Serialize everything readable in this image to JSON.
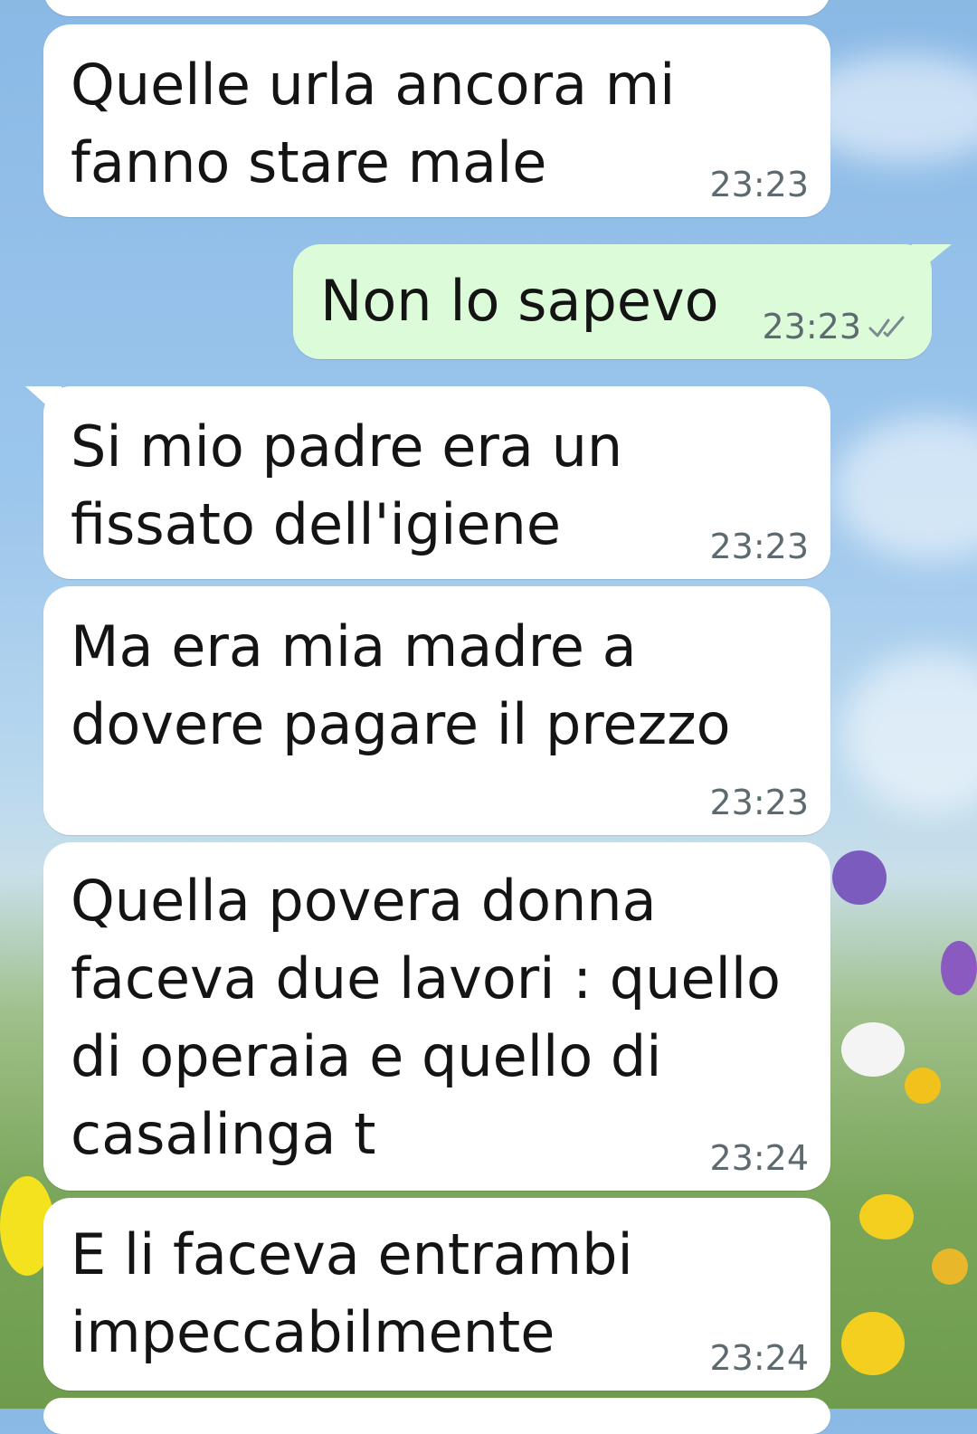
{
  "chat": {
    "messages": [
      {
        "text": "",
        "time": ""
      },
      {
        "text": "Quelle urla ancora mi\nfanno stare male",
        "time": "23:23"
      },
      {
        "text": "Non lo sapevo",
        "time": "23:23",
        "status": "read-ticks-icon"
      },
      {
        "text": "Si mio padre era un\nfissato dell'igiene",
        "time": "23:23"
      },
      {
        "text": "Ma era mia madre a\ndovere pagare il prezzo",
        "time": "23:23"
      },
      {
        "text": "Quella povera donna\nfaceva due lavori : quello\ndi operaia e quello di\ncasalinga t",
        "time": "23:24"
      },
      {
        "text": "E li faceva entrambi\nimpeccabilmente",
        "time": "23:24"
      }
    ]
  },
  "colors": {
    "incoming_bubble": "#ffffff",
    "outgoing_bubble": "#dcfcd9",
    "timestamp": "#5d6a70"
  }
}
